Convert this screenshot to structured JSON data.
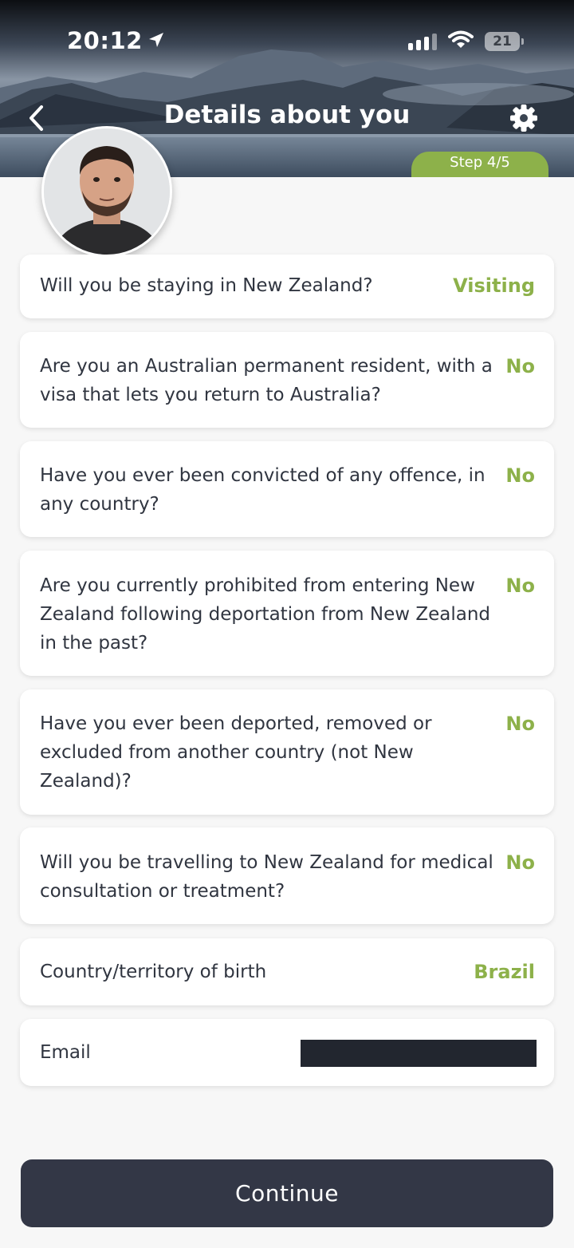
{
  "status_bar": {
    "time": "20:12",
    "battery": "21"
  },
  "header": {
    "title": "Details about you",
    "step": "Step 4/5"
  },
  "questions": [
    {
      "label": "Will you be staying in New Zealand?",
      "value": "Visiting"
    },
    {
      "label": "Are you an Australian permanent resident, with a visa that lets you return to Australia?",
      "value": "No"
    },
    {
      "label": "Have you ever been convicted of any offence, in any country?",
      "value": "No"
    },
    {
      "label": "Are you currently prohibited from entering New Zealand following deportation from New Zealand in the past?",
      "value": "No"
    },
    {
      "label": "Have you ever been deported, removed or excluded from another country (not New Zealand)?",
      "value": "No"
    },
    {
      "label": "Will you be travelling to New Zealand for medical consultation or treatment?",
      "value": "No"
    },
    {
      "label": "Country/territory of birth",
      "value": "Brazil"
    },
    {
      "label": "Email",
      "value": ""
    }
  ],
  "actions": {
    "continue_label": "Continue"
  },
  "colors": {
    "accent": "#8db14a",
    "button": "#333746",
    "text": "#303540"
  }
}
